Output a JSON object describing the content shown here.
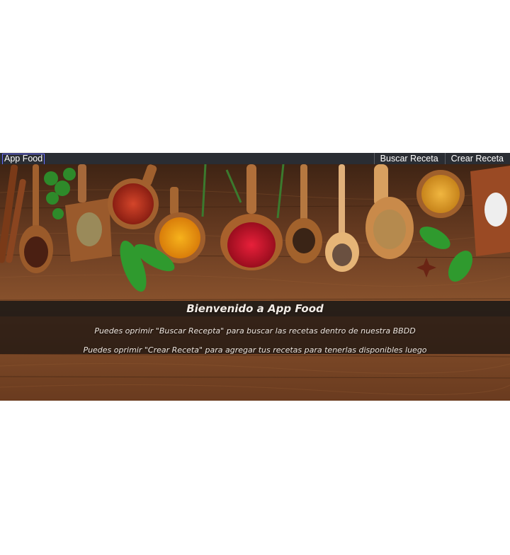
{
  "navbar": {
    "brand": "App Food",
    "links": [
      {
        "label": "Buscar Receta"
      },
      {
        "label": "Crear Receta"
      }
    ]
  },
  "hero": {
    "title": "Bienvenido a App Food",
    "lines": [
      "Puedes oprimir \"Buscar Recepta\" para buscar las recetas dentro de nuestra BBDD",
      "Puedes oprimir \"Crear Receta\" para agregar tus recetas para tenerlas disponibles luego"
    ]
  },
  "colors": {
    "navbar_bg": "#2a2d33",
    "wood": "#6b3c22",
    "banner": "#161210"
  },
  "icons": {
    "hero_image": "spices-on-wood-photo"
  }
}
